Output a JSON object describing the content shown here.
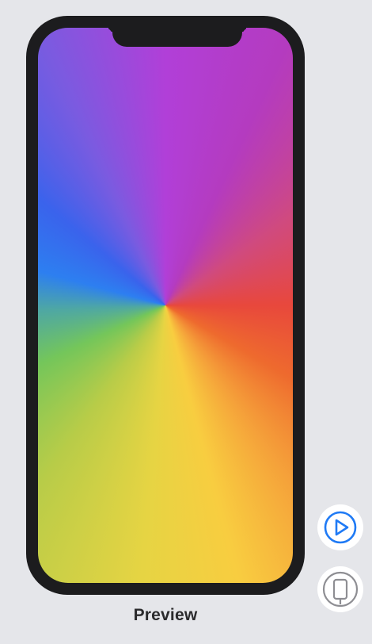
{
  "preview": {
    "label": "Preview"
  },
  "controls": {
    "live_preview_icon": "play-circle-icon",
    "device_settings_icon": "device-icon"
  },
  "colors": {
    "background": "#e5e6ea",
    "device_frame": "#1c1c1e",
    "accent": "#1f7af5",
    "icon_gray": "#8e8e93"
  },
  "screen_content": {
    "type": "angular-gradient",
    "colors": [
      "#e8483c",
      "#f8cd40",
      "#74c65a",
      "#2d7ff0",
      "#b13fd8"
    ]
  }
}
